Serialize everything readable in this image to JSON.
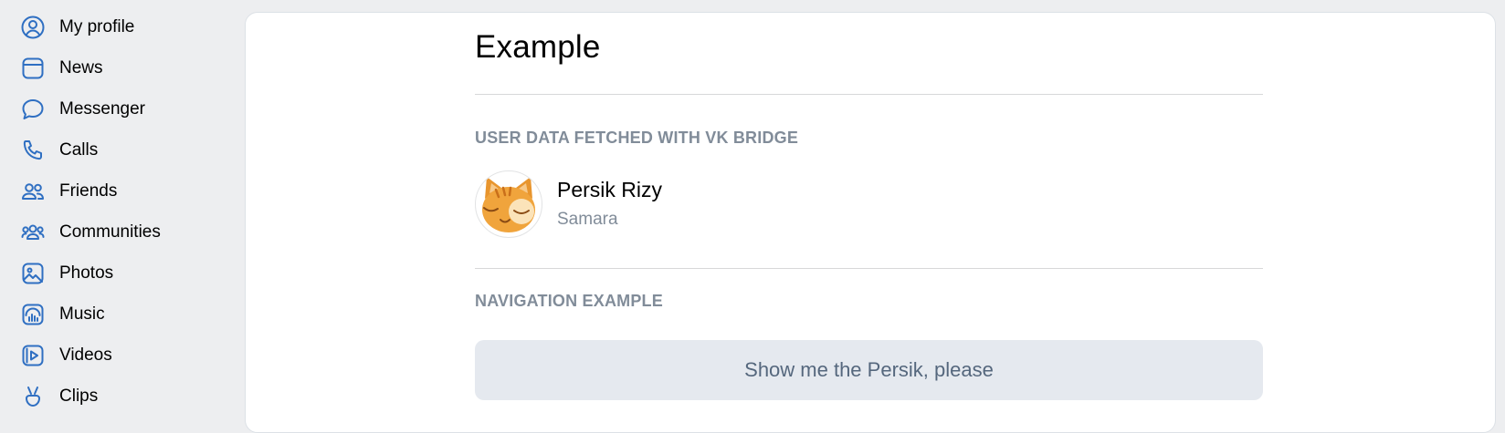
{
  "sidebar": {
    "items": [
      {
        "label": "My profile",
        "icon": "user-circle-icon"
      },
      {
        "label": "News",
        "icon": "newsfeed-icon"
      },
      {
        "label": "Messenger",
        "icon": "message-bubble-icon"
      },
      {
        "label": "Calls",
        "icon": "phone-icon"
      },
      {
        "label": "Friends",
        "icon": "users-icon"
      },
      {
        "label": "Communities",
        "icon": "users-three-icon"
      },
      {
        "label": "Photos",
        "icon": "picture-icon"
      },
      {
        "label": "Music",
        "icon": "music-icon"
      },
      {
        "label": "Videos",
        "icon": "video-icon"
      },
      {
        "label": "Clips",
        "icon": "clips-hand-icon"
      }
    ]
  },
  "main": {
    "title": "Example",
    "user_section": {
      "header": "USER DATA FETCHED WITH VK BRIDGE",
      "user": {
        "name": "Persik Rizy",
        "city": "Samara"
      }
    },
    "navigation_section": {
      "header": "NAVIGATION EXAMPLE",
      "button_label": "Show me the Persik, please"
    }
  },
  "colors": {
    "accent": "#2f6fc2",
    "background": "#edeef0",
    "panel": "#ffffff",
    "secondary_text": "#818c99",
    "button_bg": "#e5e9ef",
    "button_text": "#55677d"
  }
}
